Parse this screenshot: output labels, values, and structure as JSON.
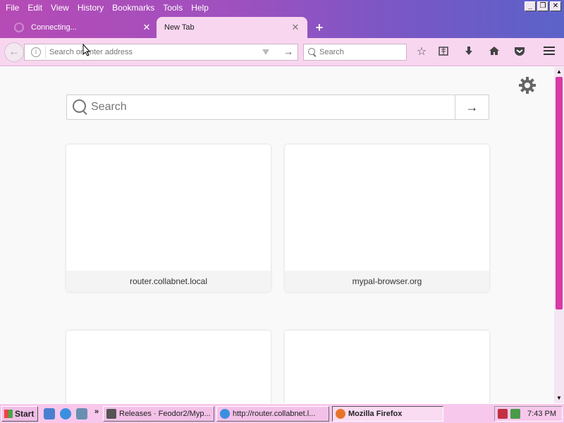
{
  "menubar": {
    "items": [
      {
        "label": "File",
        "key": "F"
      },
      {
        "label": "Edit",
        "key": "E"
      },
      {
        "label": "View",
        "key": "V"
      },
      {
        "label": "History",
        "key": "s"
      },
      {
        "label": "Bookmarks",
        "key": "B"
      },
      {
        "label": "Tools",
        "key": "T"
      },
      {
        "label": "Help",
        "key": "H"
      }
    ]
  },
  "window_controls": {
    "minimize": "_",
    "restore": "❐",
    "close": "✕"
  },
  "tabs": [
    {
      "title": "Connecting...",
      "loading": true,
      "active": false
    },
    {
      "title": "New Tab",
      "active": true
    }
  ],
  "navbar": {
    "url_placeholder": "Search or enter address",
    "search_placeholder": "Search"
  },
  "content": {
    "search_placeholder": "Search",
    "top_sites": [
      {
        "label": "router.collabnet.local"
      },
      {
        "label": "mypal-browser.org"
      },
      {
        "label": ""
      },
      {
        "label": ""
      }
    ]
  },
  "taskbar": {
    "start_label": "Start",
    "quicklaunch_chevron": "»",
    "tasks": [
      {
        "label": "Releases · Feodor2/Myp...",
        "active": false
      },
      {
        "label": "http://router.collabnet.l...",
        "active": false
      },
      {
        "label": "Mozilla Firefox",
        "active": true
      }
    ],
    "clock": "7:43 PM"
  },
  "colors": {
    "titlebar_start": "#b64bb5",
    "titlebar_end": "#5b63c9",
    "toolbar_bg": "#f9d6f0",
    "scroll_thumb": "#d63aa8",
    "taskbar_bg": "#f7c8ec"
  },
  "icons": {
    "toolbar": [
      "star-icon",
      "reading-list-icon",
      "download-icon",
      "home-icon",
      "pocket-icon",
      "hamburger-menu-icon"
    ]
  }
}
